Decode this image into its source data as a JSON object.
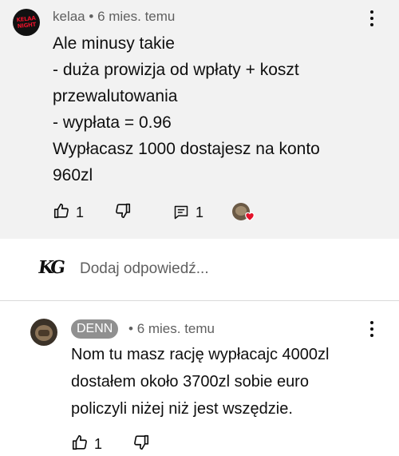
{
  "comment": {
    "author": "kelaa",
    "time": "6 mies. temu",
    "lines": [
      "Ale minusy takie",
      "- duża prowizja od wpłaty + koszt",
      "przewalutowania",
      "- wypłata = 0.96",
      "Wypłacasz 1000 dostajesz na konto",
      "960zl"
    ],
    "like_count": "1",
    "reply_count": "1",
    "avatar_logo_text": "KELAA NIGHT"
  },
  "reply_box": {
    "placeholder": "Dodaj odpowiedź...",
    "user_logo": "KG"
  },
  "reply": {
    "author": "DENN",
    "time": "6 mies. temu",
    "lines": [
      "Nom tu masz rację wypłacajc 4000zl",
      "dostałem około 3700zl sobie euro",
      "policzyli niżej niż jest wszędzie."
    ],
    "like_count": "1"
  },
  "colors": {
    "parent_bg": "#f2f2f2",
    "meta_text": "#606060",
    "author_badge_bg": "#909090",
    "heart": "#e3122a"
  },
  "icons": [
    "thumbs-up-icon",
    "thumbs-down-icon",
    "replies-icon",
    "heart-icon",
    "more-vert-icon"
  ]
}
